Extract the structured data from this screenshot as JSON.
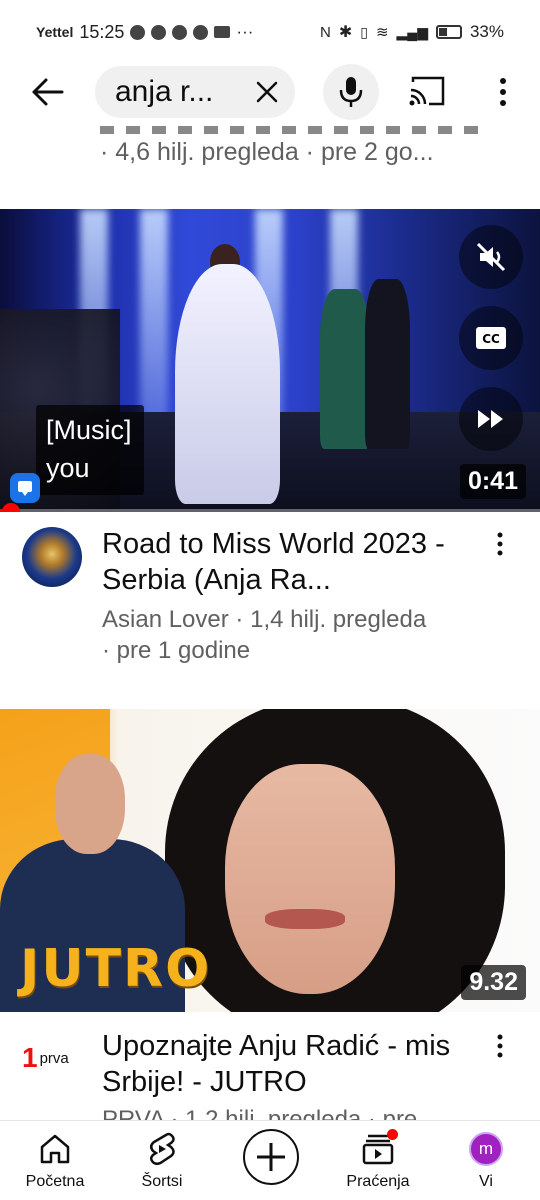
{
  "status_bar": {
    "carrier": "Yettel",
    "time": "15:25",
    "battery": "33%"
  },
  "search": {
    "query": "anja r..."
  },
  "partial_item": {
    "meta": "· 4,6 hilj. pregleda · pre 2 go..."
  },
  "video1": {
    "caption_line1": "[Music]",
    "caption_line2": "you",
    "duration": "0:41",
    "progress_fraction": 0.02,
    "title": "Road to Miss World 2023 - Serbia (Anja Ra...",
    "channel": "Asian Lover",
    "views": "1,4 hilj. pregleda",
    "age": "pre 1 godine"
  },
  "video2": {
    "duration": "9.32",
    "thumb_text": "JUTRO",
    "channel_logo_num": "1",
    "channel_logo_word": "prva",
    "title": "Upoznajte Anju Radić - mis Srbije!  - JUTRO",
    "meta_partial": "PRVA · 1,2 hilj. pregleda · pre"
  },
  "bottom_nav": {
    "home": "Početna",
    "shorts": "Šortsi",
    "subscriptions": "Praćenja",
    "you": "Vi",
    "you_avatar_letter": "m"
  },
  "colors": {
    "accent_red": "#ff0000",
    "text": "#0f0f0f",
    "secondary_text": "#606060"
  }
}
